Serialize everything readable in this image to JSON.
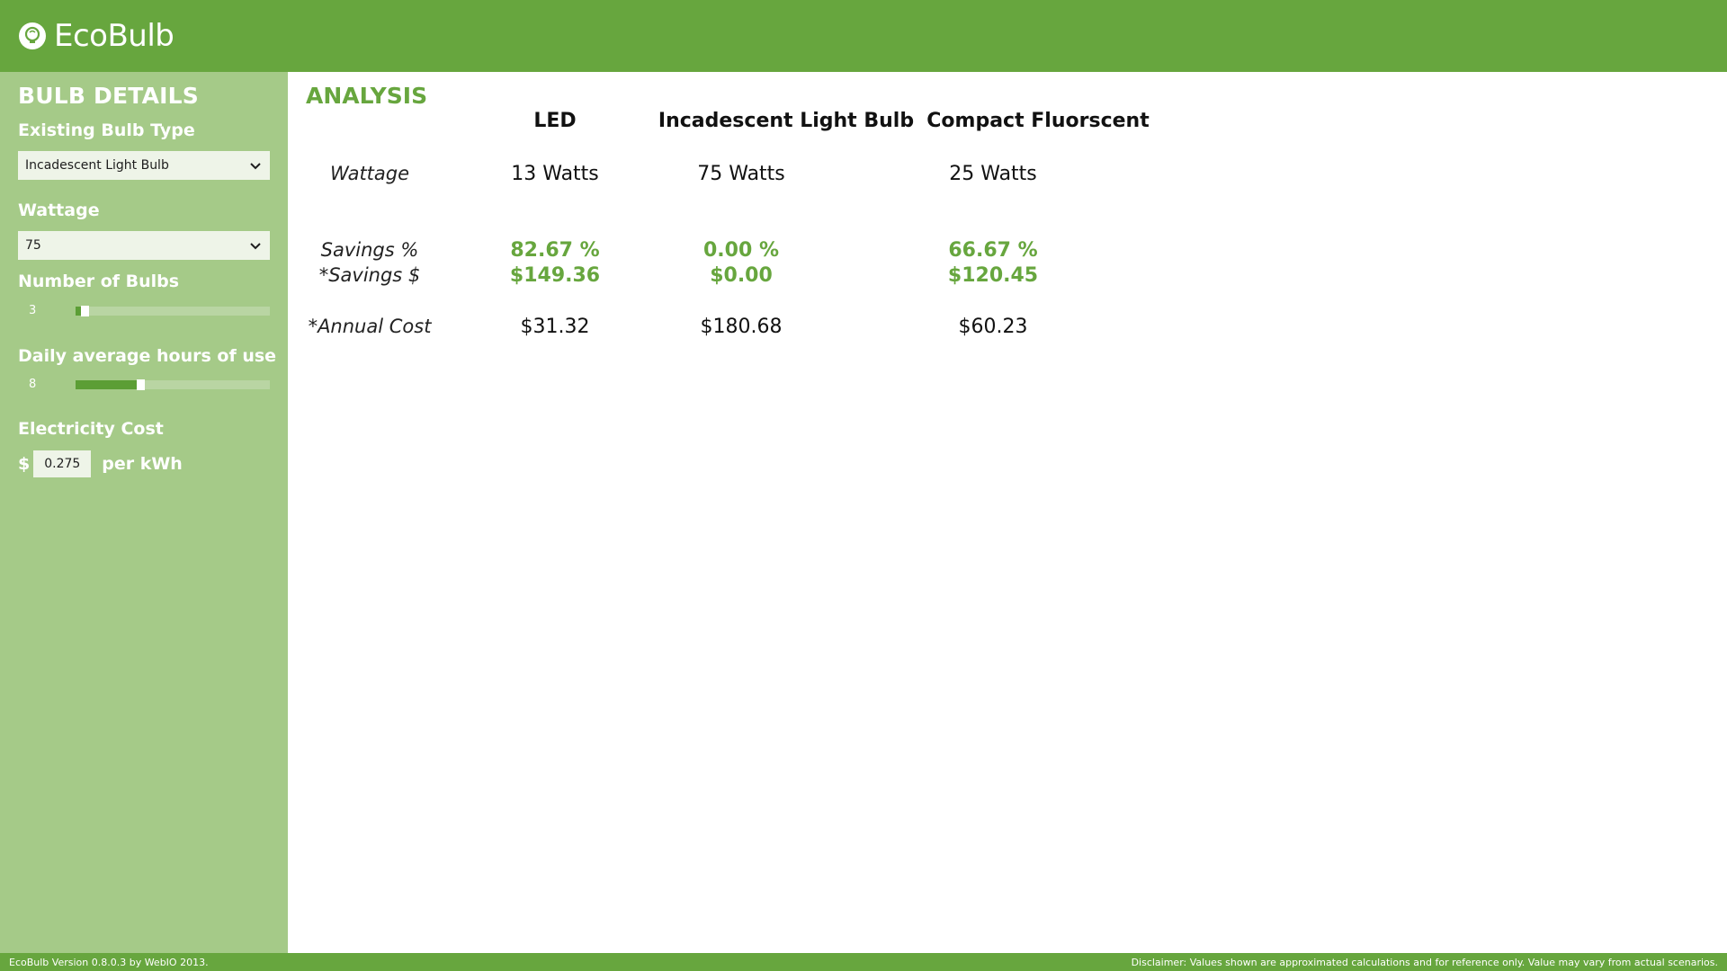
{
  "header": {
    "app_title": "EcoBulb",
    "logo_icon": "bulb-icon"
  },
  "sidebar": {
    "title": "BULB DETAILS",
    "bulb_type": {
      "label": "Existing Bulb Type",
      "selected": "Incadescent Light Bulb"
    },
    "wattage": {
      "label": "Wattage",
      "selected": "75"
    },
    "num_bulbs": {
      "label": "Number of Bulbs",
      "value": "3",
      "fraction": 0.03
    },
    "daily_hours": {
      "label": "Daily average hours of use",
      "value": "8",
      "fraction": 0.33
    },
    "electricity_cost": {
      "label": "Electricity Cost",
      "currency": "$",
      "value": "0.275",
      "unit": "per kWh"
    }
  },
  "analysis": {
    "title": "ANALYSIS",
    "columns": [
      "LED",
      "Incadescent Light Bulb",
      "Compact Fluorscent"
    ],
    "row_labels": {
      "wattage": "Wattage",
      "savings_pct": "Savings %",
      "savings_usd": "*Savings $",
      "annual_cost": "*Annual Cost"
    },
    "wattage": [
      "13 Watts",
      "75 Watts",
      "25 Watts"
    ],
    "savings_pct": [
      "82.67 %",
      "0.00 %",
      "66.67 %"
    ],
    "savings_usd": [
      "$149.36",
      "$0.00",
      "$120.45"
    ],
    "annual_cost": [
      "$31.32",
      "$180.68",
      "$60.23"
    ]
  },
  "footer": {
    "version": "EcoBulb Version 0.8.0.3 by WebIO 2013.",
    "disclaimer": "Disclaimer: Values shown are approximated calculations and for reference only. Value may vary from actual scenarios."
  },
  "colors": {
    "primary": "#67a63e",
    "sidebar": "#a5ca88",
    "accent_text": "#67a63e"
  }
}
